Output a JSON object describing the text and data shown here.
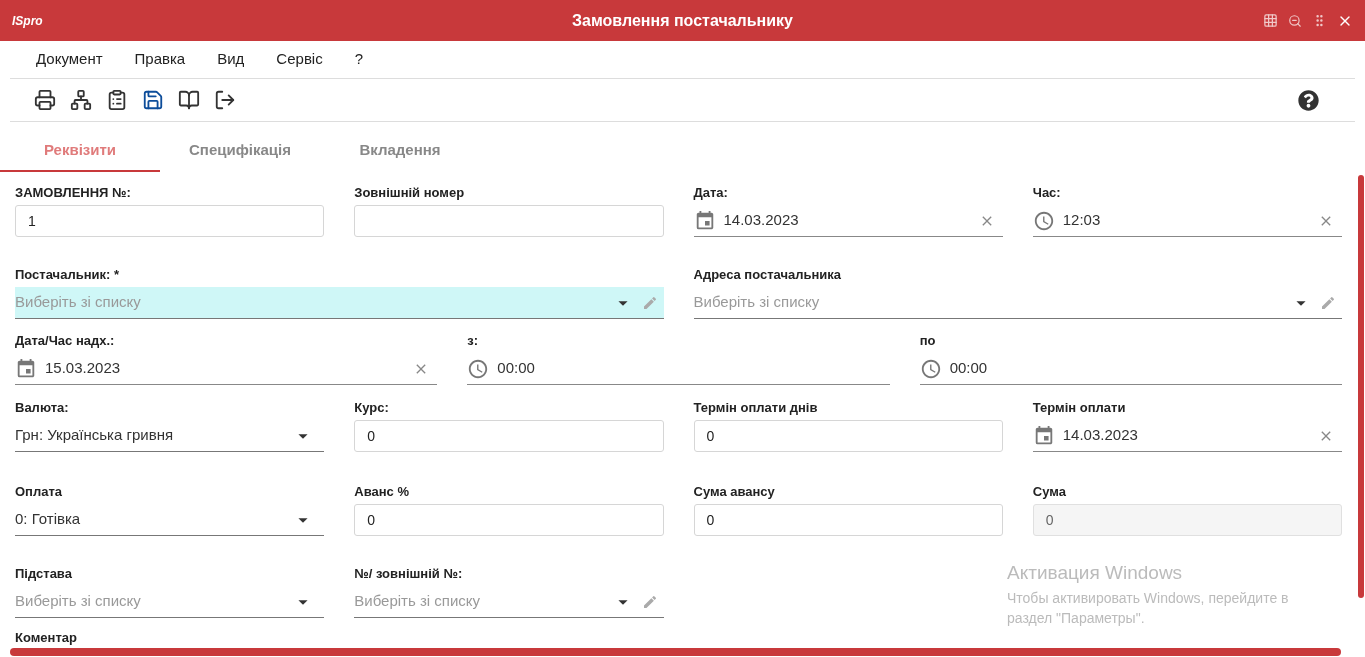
{
  "window": {
    "logo": "ISpro",
    "title": "Замовлення постачальнику"
  },
  "menu": [
    "Документ",
    "Правка",
    "Вид",
    "Сервіс",
    "?"
  ],
  "tabs": [
    {
      "label": "Реквізити",
      "selected": true
    },
    {
      "label": "Специфікація",
      "selected": false
    },
    {
      "label": "Вкладення",
      "selected": false
    }
  ],
  "rows": [
    {
      "fields": [
        {
          "label": "ЗАМОВЛЕННЯ №:",
          "kind": "text",
          "value": "1"
        },
        {
          "label": "Зовнішній номер",
          "kind": "text"
        },
        {
          "label": "Дата:",
          "kind": "date",
          "value": "14.03.2023",
          "clearable": true
        },
        {
          "label": "Час:",
          "kind": "time",
          "value": "12:03",
          "clearable": true
        }
      ]
    },
    {
      "fields": [
        {
          "label": "Постачальник: *",
          "kind": "select",
          "placeholder": "Виберіть зі списку",
          "editable": true,
          "highlighted": true
        },
        {
          "label": "Адреса постачальника",
          "kind": "select",
          "placeholder": "Виберіть зі списку",
          "editable": true,
          "highlighted": false
        }
      ]
    },
    {
      "fields": [
        {
          "label": "Дата/Час надх.:",
          "kind": "date",
          "value": "15.03.2023",
          "clearable": true
        },
        {
          "label": "з:",
          "kind": "time",
          "value": "00:00",
          "clearable": false
        },
        {
          "label": "по",
          "kind": "time",
          "value": "00:00",
          "clearable": false
        }
      ]
    },
    {
      "fields": [
        {
          "label": "Валюта:",
          "kind": "select",
          "value": "Грн: Українська гривня",
          "editable": false,
          "highlighted": false
        },
        {
          "label": "Курс:",
          "kind": "text",
          "value": "0"
        },
        {
          "label": "Термін оплати днів",
          "kind": "text",
          "value": "0"
        },
        {
          "label": "Термін оплати",
          "kind": "date",
          "value": "14.03.2023",
          "clearable": true
        }
      ]
    },
    {
      "fields": [
        {
          "label": "Оплата",
          "kind": "select",
          "value": "0: Готівка",
          "editable": false,
          "highlighted": false
        },
        {
          "label": "Аванс %",
          "kind": "text",
          "value": "0"
        },
        {
          "label": "Сума авансу",
          "kind": "text",
          "value": "0"
        },
        {
          "label": "Сума",
          "kind": "readonly",
          "value": "0"
        }
      ]
    },
    {
      "fields": [
        {
          "label": "Підстава",
          "kind": "select",
          "placeholder": "Виберіть зі списку",
          "editable": false,
          "highlighted": false
        },
        {
          "label": "№/ зовнішній №:",
          "kind": "select",
          "placeholder": "Виберіть зі списку",
          "editable": true,
          "highlighted": false
        }
      ]
    },
    {
      "fields": [
        {
          "label": "Коментар",
          "kind": "label"
        }
      ]
    }
  ],
  "activation_notice": {
    "title": "Активация Windows",
    "text": "Чтобы активировать Windows, перейдите в раздел \"Параметры\"."
  }
}
